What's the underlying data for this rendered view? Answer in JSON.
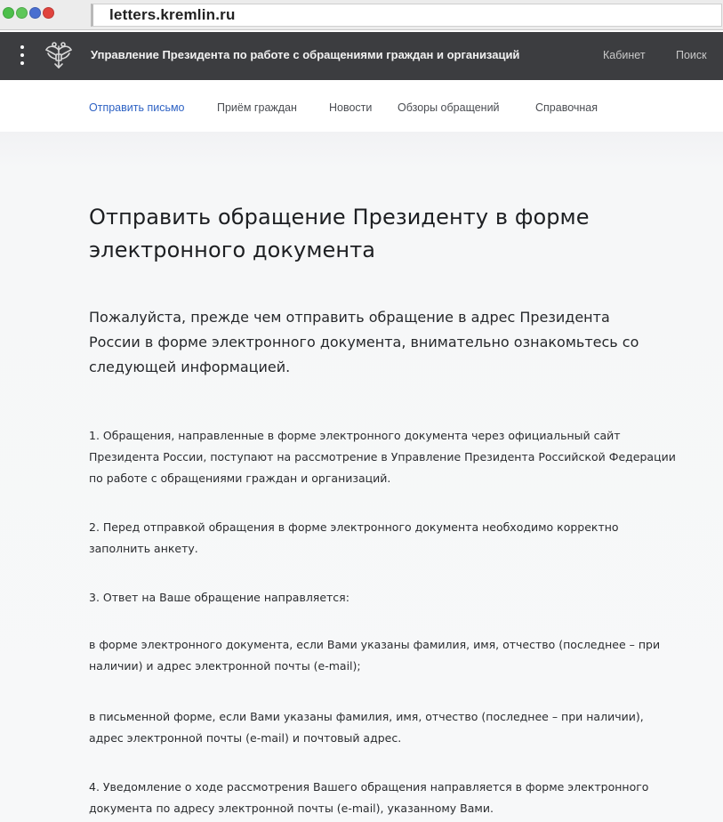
{
  "browser": {
    "url": "letters.kremlin.ru",
    "buttons": [
      {
        "name": "green",
        "color": "#4cbf4a"
      },
      {
        "name": "green2",
        "color": "#5fc75a"
      },
      {
        "name": "blue",
        "color": "#4a6fd0"
      },
      {
        "name": "red",
        "color": "#e0443e"
      }
    ]
  },
  "header": {
    "title": "Управление Президента по работе с обращениями граждан и организаций",
    "cabinet": "Кабинет",
    "search": "Поиск",
    "emblem_icon": "emblem-icon",
    "menu_icon": "menu-dots-icon"
  },
  "nav": {
    "items": [
      {
        "label": "Отправить письмо",
        "active": true
      },
      {
        "label": "Приём граждан",
        "active": false
      },
      {
        "label": "Новости",
        "active": false
      },
      {
        "label": "Обзоры обращений",
        "active": false
      },
      {
        "label": "Справочная",
        "active": false
      }
    ]
  },
  "main": {
    "title": "Отправить обращение Президенту в форме электронного документа",
    "intro": "Пожалуйста, прежде чем отправить обращение в адрес Президента России в форме электронного документа, внимательно ознакомьтесь со следующей информацией.",
    "paragraphs": [
      "1. Обращения, направленные в форме электронного документа через официальный сайт Президента России, поступают на рассмотрение в Управление Президента Российской Федерации по работе с обращениями граждан и организаций.",
      "2. Перед отправкой обращения в форме электронного документа необходимо корректно заполнить анкету.",
      "3. Ответ на Ваше обращение направляется:",
      "в форме электронного документа, если Вами указаны фамилия, имя, отчество (последнее – при наличии) и адрес электронной почты (e-mail);",
      "в письменной форме, если Вами указаны фамилия, имя, отчество (последнее – при наличии), адрес электронной почты (e-mail) и почтовый адрес.",
      "4. Уведомление о ходе рассмотрения Вашего обращения направляется в форме электронного документа по адресу электронной почты (e-mail), указанному Вами."
    ]
  },
  "colors": {
    "header_bg": "#3c3d40",
    "nav_active": "#2f63c4",
    "content_bg": "#f6f7f8"
  }
}
